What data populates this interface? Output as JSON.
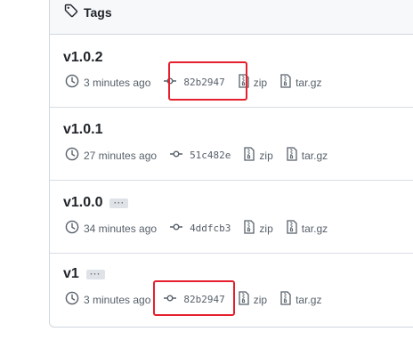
{
  "header": {
    "title": "Tags",
    "icon": "tag-icon"
  },
  "colors": {
    "highlight": "#e5202e",
    "muted_text": "#57606a",
    "header_bg": "#f6f8fa"
  },
  "tags": [
    {
      "name": "v1.0.2",
      "has_menu": false,
      "time": "3 minutes ago",
      "commit": "82b2947",
      "zip_label": "zip",
      "tar_label": "tar.gz",
      "commit_highlighted": true
    },
    {
      "name": "v1.0.1",
      "has_menu": false,
      "time": "27 minutes ago",
      "commit": "51c482e",
      "zip_label": "zip",
      "tar_label": "tar.gz",
      "commit_highlighted": false
    },
    {
      "name": "v1.0.0",
      "has_menu": true,
      "menu_label": "···",
      "time": "34 minutes ago",
      "commit": "4ddfcb3",
      "zip_label": "zip",
      "tar_label": "tar.gz",
      "commit_highlighted": false
    },
    {
      "name": "v1",
      "has_menu": true,
      "menu_label": "···",
      "time": "3 minutes ago",
      "commit": "82b2947",
      "zip_label": "zip",
      "tar_label": "tar.gz",
      "commit_highlighted": true
    }
  ]
}
